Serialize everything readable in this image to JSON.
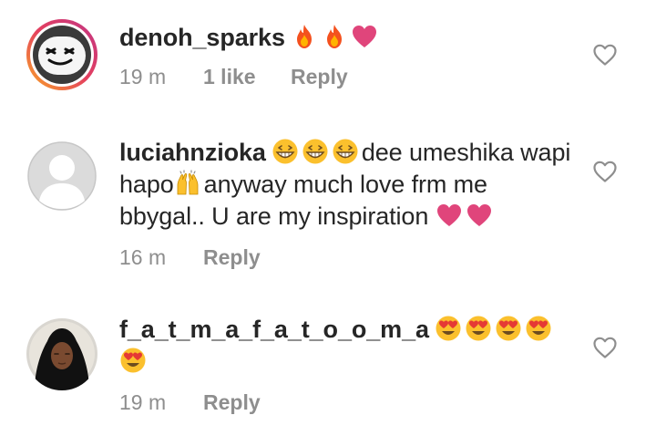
{
  "comments": [
    {
      "username": "denoh_sparks",
      "text": "",
      "emojis": [
        "fire-emoji",
        "fire-emoji",
        "pink-heart-emoji"
      ],
      "time": "19 m",
      "likes": "1 like",
      "reply": "Reply"
    },
    {
      "username": "luciahnzioka",
      "text_part1": "dee umeshika wapi hapo",
      "text_part2": "anyway much love frm me bbygal.. U are my inspiration",
      "emojis_lead": [
        "grinning-squint-emoji",
        "grinning-squint-emoji",
        "grinning-squint-emoji"
      ],
      "emoji_mid": "raising-hands-emoji",
      "emojis_tail": [
        "pink-heart-emoji",
        "pink-heart-emoji"
      ],
      "time": "16 m",
      "reply": "Reply"
    },
    {
      "username": "f_a_t_m_a_f_a_t_o_o_m_a",
      "emojis": [
        "heart-eyes-emoji",
        "heart-eyes-emoji",
        "heart-eyes-emoji",
        "heart-eyes-emoji",
        "heart-eyes-emoji"
      ],
      "time": "19 m",
      "reply": "Reply"
    }
  ],
  "colors": {
    "text": "#262626",
    "meta": "#8e8e8e",
    "heart": "#e0457b",
    "fire": "#f4511e",
    "emoji_face": "#fbc02d"
  }
}
